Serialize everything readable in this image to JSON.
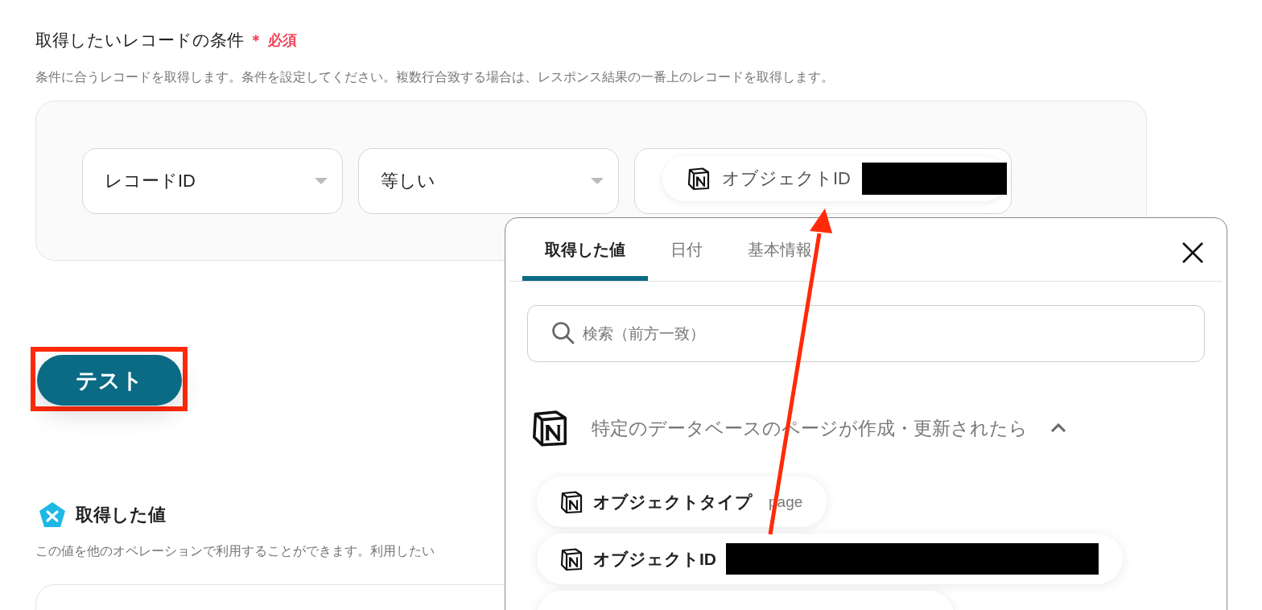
{
  "condition": {
    "title": "取得したいレコードの条件",
    "required_mark": "＊",
    "required_label": "必須",
    "description": "条件に合うレコードを取得します。条件を設定してください。複数行合致する場合は、レスポンス結果の一番上のレコードを取得します。",
    "field": {
      "value": "レコードID"
    },
    "operator": {
      "value": "等しい"
    },
    "value_chip": {
      "label": "オブジェクトID",
      "redacted": true
    }
  },
  "test_button": {
    "label": "テスト",
    "highlighted": true
  },
  "output": {
    "title": "取得した値",
    "description": "この値を他のオペレーションで利用することができます。利用したい"
  },
  "popup": {
    "tabs": [
      {
        "label": "取得した値",
        "selected": true
      },
      {
        "label": "日付",
        "selected": false
      },
      {
        "label": "基本情報",
        "selected": false
      }
    ],
    "search": {
      "placeholder": "検索（前方一致）"
    },
    "group": {
      "title": "特定のデータベースのページが作成・更新されたら",
      "expanded": true,
      "items": [
        {
          "label": "オブジェクトタイプ",
          "value": "page",
          "redacted": false
        },
        {
          "label": "オブジェクトID",
          "redacted": true
        }
      ]
    }
  }
}
